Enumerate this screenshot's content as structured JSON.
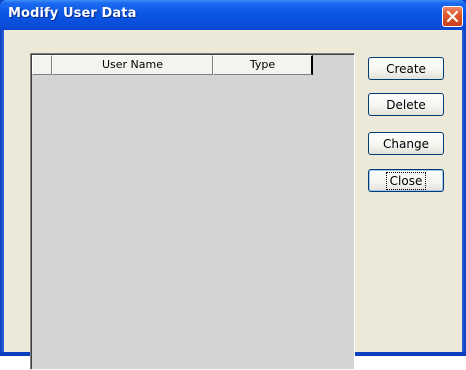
{
  "window": {
    "title": "Modify User Data"
  },
  "table": {
    "columns": [
      "",
      "User Name",
      "Type"
    ],
    "rows": []
  },
  "buttons": {
    "create": "Create",
    "delete": "Delete",
    "change": "Change",
    "close": "Close"
  },
  "icons": {
    "title_close": "close-icon"
  },
  "colors": {
    "titlebar": "#0a56e6",
    "client_bg": "#ece9d8",
    "list_bg": "#d4d4d4",
    "close_button": "#e0582e"
  }
}
